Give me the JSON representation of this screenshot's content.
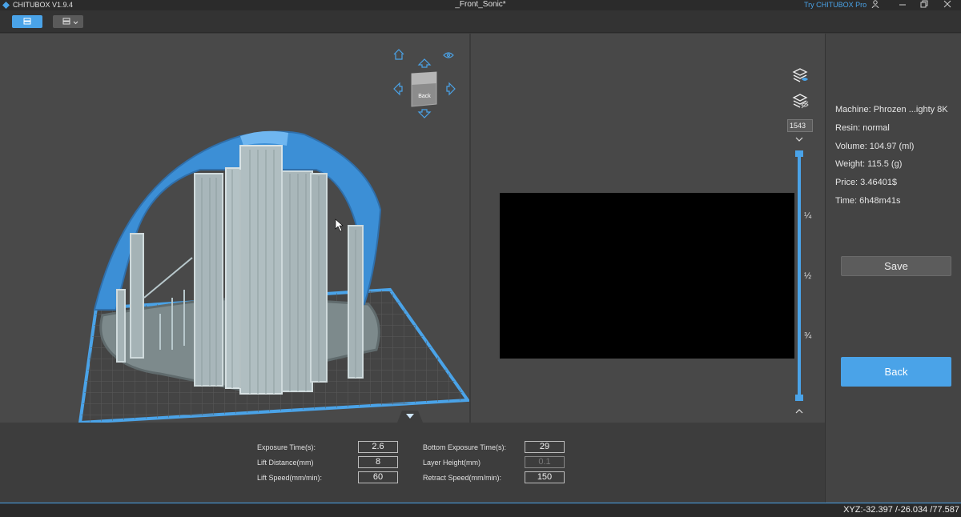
{
  "titlebar": {
    "app_name": "CHITUBOX V1.9.4",
    "document_title": "_Front_Sonic*",
    "try_pro": "Try CHITUBOX Pro"
  },
  "viewcube": {
    "face_top": "Back",
    "face_front": "Back"
  },
  "preview": {
    "layer_number": "1543",
    "fractions": [
      "¼",
      "½",
      "¾"
    ]
  },
  "info": {
    "machine": "Machine:  Phrozen ...ighty 8K",
    "resin": "Resin:  normal",
    "volume": "Volume:  104.97  (ml)",
    "weight": "Weight:  115.5  (g)",
    "price": "Price:  3.46401$",
    "time": "Time:  6h48m41s"
  },
  "buttons": {
    "save": "Save",
    "back": "Back"
  },
  "params": {
    "exposure_time": {
      "label": "Exposure Time(s):",
      "value": "2.6"
    },
    "lift_distance": {
      "label": "Lift Distance(mm)",
      "value": "8"
    },
    "lift_speed": {
      "label": "Lift Speed(mm/min):",
      "value": "60"
    },
    "bottom_exposure": {
      "label": "Bottom Exposure Time(s):",
      "value": "29"
    },
    "layer_height": {
      "label": "Layer Height(mm)",
      "value": "0.1"
    },
    "retract_speed": {
      "label": "Retract Speed(mm/min):",
      "value": "150"
    }
  },
  "status": {
    "xyz": "XYZ:-32.397 /-26.034 /77.587"
  },
  "colors": {
    "accent": "#4aa3e8",
    "model_shell": "#3c8fd6",
    "supports": "#b8c8cc"
  }
}
